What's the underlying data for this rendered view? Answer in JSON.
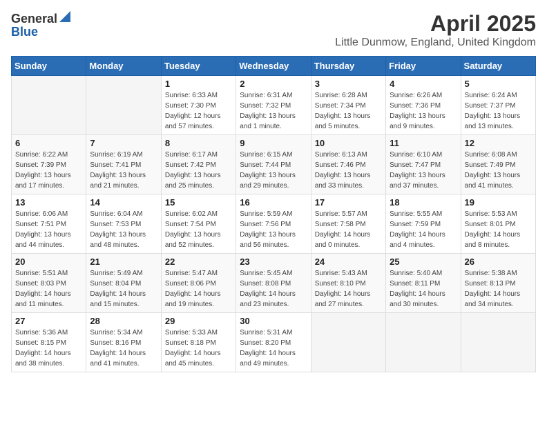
{
  "logo": {
    "general": "General",
    "blue": "Blue"
  },
  "title": {
    "month_year": "April 2025",
    "location": "Little Dunmow, England, United Kingdom"
  },
  "weekdays": [
    "Sunday",
    "Monday",
    "Tuesday",
    "Wednesday",
    "Thursday",
    "Friday",
    "Saturday"
  ],
  "weeks": [
    [
      {
        "day": "",
        "sunrise": "",
        "sunset": "",
        "daylight": ""
      },
      {
        "day": "",
        "sunrise": "",
        "sunset": "",
        "daylight": ""
      },
      {
        "day": "1",
        "sunrise": "Sunrise: 6:33 AM",
        "sunset": "Sunset: 7:30 PM",
        "daylight": "Daylight: 12 hours and 57 minutes."
      },
      {
        "day": "2",
        "sunrise": "Sunrise: 6:31 AM",
        "sunset": "Sunset: 7:32 PM",
        "daylight": "Daylight: 13 hours and 1 minute."
      },
      {
        "day": "3",
        "sunrise": "Sunrise: 6:28 AM",
        "sunset": "Sunset: 7:34 PM",
        "daylight": "Daylight: 13 hours and 5 minutes."
      },
      {
        "day": "4",
        "sunrise": "Sunrise: 6:26 AM",
        "sunset": "Sunset: 7:36 PM",
        "daylight": "Daylight: 13 hours and 9 minutes."
      },
      {
        "day": "5",
        "sunrise": "Sunrise: 6:24 AM",
        "sunset": "Sunset: 7:37 PM",
        "daylight": "Daylight: 13 hours and 13 minutes."
      }
    ],
    [
      {
        "day": "6",
        "sunrise": "Sunrise: 6:22 AM",
        "sunset": "Sunset: 7:39 PM",
        "daylight": "Daylight: 13 hours and 17 minutes."
      },
      {
        "day": "7",
        "sunrise": "Sunrise: 6:19 AM",
        "sunset": "Sunset: 7:41 PM",
        "daylight": "Daylight: 13 hours and 21 minutes."
      },
      {
        "day": "8",
        "sunrise": "Sunrise: 6:17 AM",
        "sunset": "Sunset: 7:42 PM",
        "daylight": "Daylight: 13 hours and 25 minutes."
      },
      {
        "day": "9",
        "sunrise": "Sunrise: 6:15 AM",
        "sunset": "Sunset: 7:44 PM",
        "daylight": "Daylight: 13 hours and 29 minutes."
      },
      {
        "day": "10",
        "sunrise": "Sunrise: 6:13 AM",
        "sunset": "Sunset: 7:46 PM",
        "daylight": "Daylight: 13 hours and 33 minutes."
      },
      {
        "day": "11",
        "sunrise": "Sunrise: 6:10 AM",
        "sunset": "Sunset: 7:47 PM",
        "daylight": "Daylight: 13 hours and 37 minutes."
      },
      {
        "day": "12",
        "sunrise": "Sunrise: 6:08 AM",
        "sunset": "Sunset: 7:49 PM",
        "daylight": "Daylight: 13 hours and 41 minutes."
      }
    ],
    [
      {
        "day": "13",
        "sunrise": "Sunrise: 6:06 AM",
        "sunset": "Sunset: 7:51 PM",
        "daylight": "Daylight: 13 hours and 44 minutes."
      },
      {
        "day": "14",
        "sunrise": "Sunrise: 6:04 AM",
        "sunset": "Sunset: 7:53 PM",
        "daylight": "Daylight: 13 hours and 48 minutes."
      },
      {
        "day": "15",
        "sunrise": "Sunrise: 6:02 AM",
        "sunset": "Sunset: 7:54 PM",
        "daylight": "Daylight: 13 hours and 52 minutes."
      },
      {
        "day": "16",
        "sunrise": "Sunrise: 5:59 AM",
        "sunset": "Sunset: 7:56 PM",
        "daylight": "Daylight: 13 hours and 56 minutes."
      },
      {
        "day": "17",
        "sunrise": "Sunrise: 5:57 AM",
        "sunset": "Sunset: 7:58 PM",
        "daylight": "Daylight: 14 hours and 0 minutes."
      },
      {
        "day": "18",
        "sunrise": "Sunrise: 5:55 AM",
        "sunset": "Sunset: 7:59 PM",
        "daylight": "Daylight: 14 hours and 4 minutes."
      },
      {
        "day": "19",
        "sunrise": "Sunrise: 5:53 AM",
        "sunset": "Sunset: 8:01 PM",
        "daylight": "Daylight: 14 hours and 8 minutes."
      }
    ],
    [
      {
        "day": "20",
        "sunrise": "Sunrise: 5:51 AM",
        "sunset": "Sunset: 8:03 PM",
        "daylight": "Daylight: 14 hours and 11 minutes."
      },
      {
        "day": "21",
        "sunrise": "Sunrise: 5:49 AM",
        "sunset": "Sunset: 8:04 PM",
        "daylight": "Daylight: 14 hours and 15 minutes."
      },
      {
        "day": "22",
        "sunrise": "Sunrise: 5:47 AM",
        "sunset": "Sunset: 8:06 PM",
        "daylight": "Daylight: 14 hours and 19 minutes."
      },
      {
        "day": "23",
        "sunrise": "Sunrise: 5:45 AM",
        "sunset": "Sunset: 8:08 PM",
        "daylight": "Daylight: 14 hours and 23 minutes."
      },
      {
        "day": "24",
        "sunrise": "Sunrise: 5:43 AM",
        "sunset": "Sunset: 8:10 PM",
        "daylight": "Daylight: 14 hours and 27 minutes."
      },
      {
        "day": "25",
        "sunrise": "Sunrise: 5:40 AM",
        "sunset": "Sunset: 8:11 PM",
        "daylight": "Daylight: 14 hours and 30 minutes."
      },
      {
        "day": "26",
        "sunrise": "Sunrise: 5:38 AM",
        "sunset": "Sunset: 8:13 PM",
        "daylight": "Daylight: 14 hours and 34 minutes."
      }
    ],
    [
      {
        "day": "27",
        "sunrise": "Sunrise: 5:36 AM",
        "sunset": "Sunset: 8:15 PM",
        "daylight": "Daylight: 14 hours and 38 minutes."
      },
      {
        "day": "28",
        "sunrise": "Sunrise: 5:34 AM",
        "sunset": "Sunset: 8:16 PM",
        "daylight": "Daylight: 14 hours and 41 minutes."
      },
      {
        "day": "29",
        "sunrise": "Sunrise: 5:33 AM",
        "sunset": "Sunset: 8:18 PM",
        "daylight": "Daylight: 14 hours and 45 minutes."
      },
      {
        "day": "30",
        "sunrise": "Sunrise: 5:31 AM",
        "sunset": "Sunset: 8:20 PM",
        "daylight": "Daylight: 14 hours and 49 minutes."
      },
      {
        "day": "",
        "sunrise": "",
        "sunset": "",
        "daylight": ""
      },
      {
        "day": "",
        "sunrise": "",
        "sunset": "",
        "daylight": ""
      },
      {
        "day": "",
        "sunrise": "",
        "sunset": "",
        "daylight": ""
      }
    ]
  ]
}
